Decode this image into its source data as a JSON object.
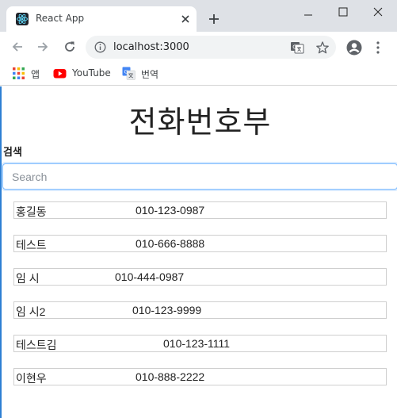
{
  "browser": {
    "tab_title": "React App",
    "url": "localhost:3000",
    "bookmarks": [
      {
        "label": "앱",
        "icon": "apps-grid-icon"
      },
      {
        "label": "YouTube",
        "icon": "youtube-icon"
      },
      {
        "label": "번역",
        "icon": "google-translate-icon"
      }
    ]
  },
  "page": {
    "title": "전화번호부",
    "search_label": "검색",
    "search_placeholder": "Search",
    "search_value": ""
  },
  "contacts": [
    {
      "name": "홍길동",
      "phone": "010-123-0987"
    },
    {
      "name": "테스트",
      "phone": "010-666-8888"
    },
    {
      "name": "임 시",
      "phone": "010-444-0987"
    },
    {
      "name": "임 시2",
      "phone": "010-123-9999"
    },
    {
      "name": "테스트김",
      "phone": "010-123-1111"
    },
    {
      "name": "이현우",
      "phone": "010-888-2222"
    }
  ],
  "colors": {
    "accent": "#80bdff",
    "page_border": "#2d7fd3",
    "row_border": "#cfcfcf"
  }
}
